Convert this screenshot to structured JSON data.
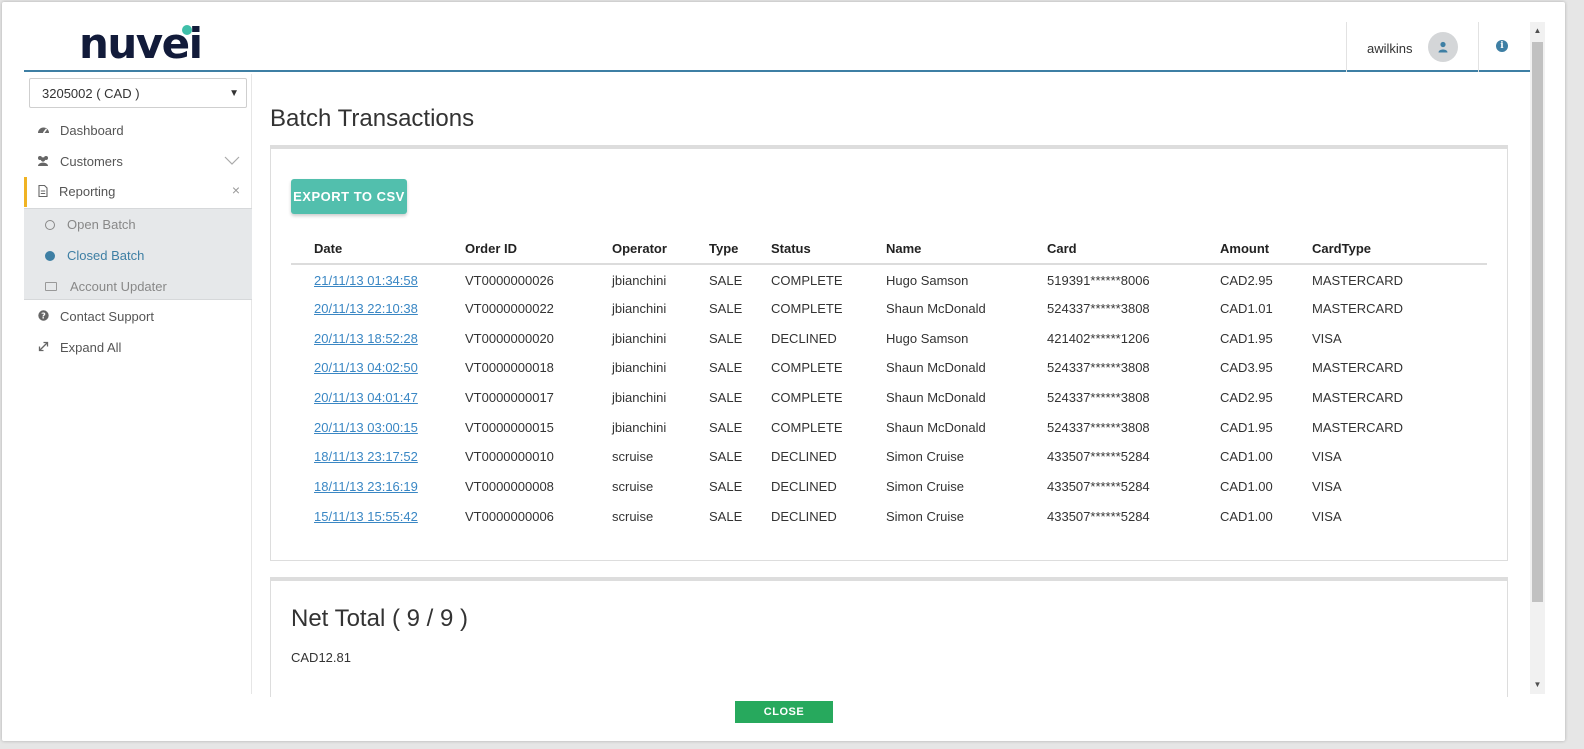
{
  "brand": {
    "logo_text": "nuvei"
  },
  "header": {
    "username": "awilkins",
    "avatar_icon": "user-icon",
    "info_icon": "info-icon"
  },
  "account_selector": {
    "value": "3205002 ( CAD )"
  },
  "sidebar": {
    "items": [
      {
        "label": "Dashboard",
        "icon": "dashboard-icon"
      },
      {
        "label": "Customers",
        "icon": "users-icon"
      },
      {
        "label": "Reporting",
        "icon": "document-icon"
      },
      {
        "label": "Contact Support",
        "icon": "question-icon"
      },
      {
        "label": "Expand All",
        "icon": "expand-icon"
      }
    ],
    "reporting_sub": [
      {
        "label": "Open Batch"
      },
      {
        "label": "Closed Batch"
      },
      {
        "label": "Account Updater"
      }
    ]
  },
  "page": {
    "title": "Batch Transactions"
  },
  "toolbar": {
    "export_label": "EXPORT TO CSV"
  },
  "table": {
    "columns": [
      "Date",
      "Order ID",
      "Operator",
      "Type",
      "Status",
      "Name",
      "Card",
      "Amount",
      "CardType"
    ],
    "rows": [
      [
        "21/11/13 01:34:58",
        "VT0000000026",
        "jbianchini",
        "SALE",
        "COMPLETE",
        "Hugo Samson",
        "519391******8006",
        "CAD2.95",
        "MASTERCARD"
      ],
      [
        "20/11/13 22:10:38",
        "VT0000000022",
        "jbianchini",
        "SALE",
        "COMPLETE",
        "Shaun McDonald",
        "524337******3808",
        "CAD1.01",
        "MASTERCARD"
      ],
      [
        "20/11/13 18:52:28",
        "VT0000000020",
        "jbianchini",
        "SALE",
        "DECLINED",
        "Hugo Samson",
        "421402******1206",
        "CAD1.95",
        "VISA"
      ],
      [
        "20/11/13 04:02:50",
        "VT0000000018",
        "jbianchini",
        "SALE",
        "COMPLETE",
        "Shaun McDonald",
        "524337******3808",
        "CAD3.95",
        "MASTERCARD"
      ],
      [
        "20/11/13 04:01:47",
        "VT0000000017",
        "jbianchini",
        "SALE",
        "COMPLETE",
        "Shaun McDonald",
        "524337******3808",
        "CAD2.95",
        "MASTERCARD"
      ],
      [
        "20/11/13 03:00:15",
        "VT0000000015",
        "jbianchini",
        "SALE",
        "COMPLETE",
        "Shaun McDonald",
        "524337******3808",
        "CAD1.95",
        "MASTERCARD"
      ],
      [
        "18/11/13 23:17:52",
        "VT0000000010",
        "scruise",
        "SALE",
        "DECLINED",
        "Simon Cruise",
        "433507******5284",
        "CAD1.00",
        "VISA"
      ],
      [
        "18/11/13 23:16:19",
        "VT0000000008",
        "scruise",
        "SALE",
        "DECLINED",
        "Simon Cruise",
        "433507******5284",
        "CAD1.00",
        "VISA"
      ],
      [
        "15/11/13 15:55:42",
        "VT0000000006",
        "scruise",
        "SALE",
        "DECLINED",
        "Simon Cruise",
        "433507******5284",
        "CAD1.00",
        "VISA"
      ]
    ]
  },
  "net_total": {
    "title": "Net Total ( 9 / 9 )",
    "value": "CAD12.81"
  },
  "footer": {
    "close_label": "CLOSE"
  },
  "colors": {
    "accent": "#3e7fa4",
    "export": "#52bfad",
    "close": "#27a95d",
    "active_marker": "#f0b323",
    "link": "#3a87c4"
  }
}
